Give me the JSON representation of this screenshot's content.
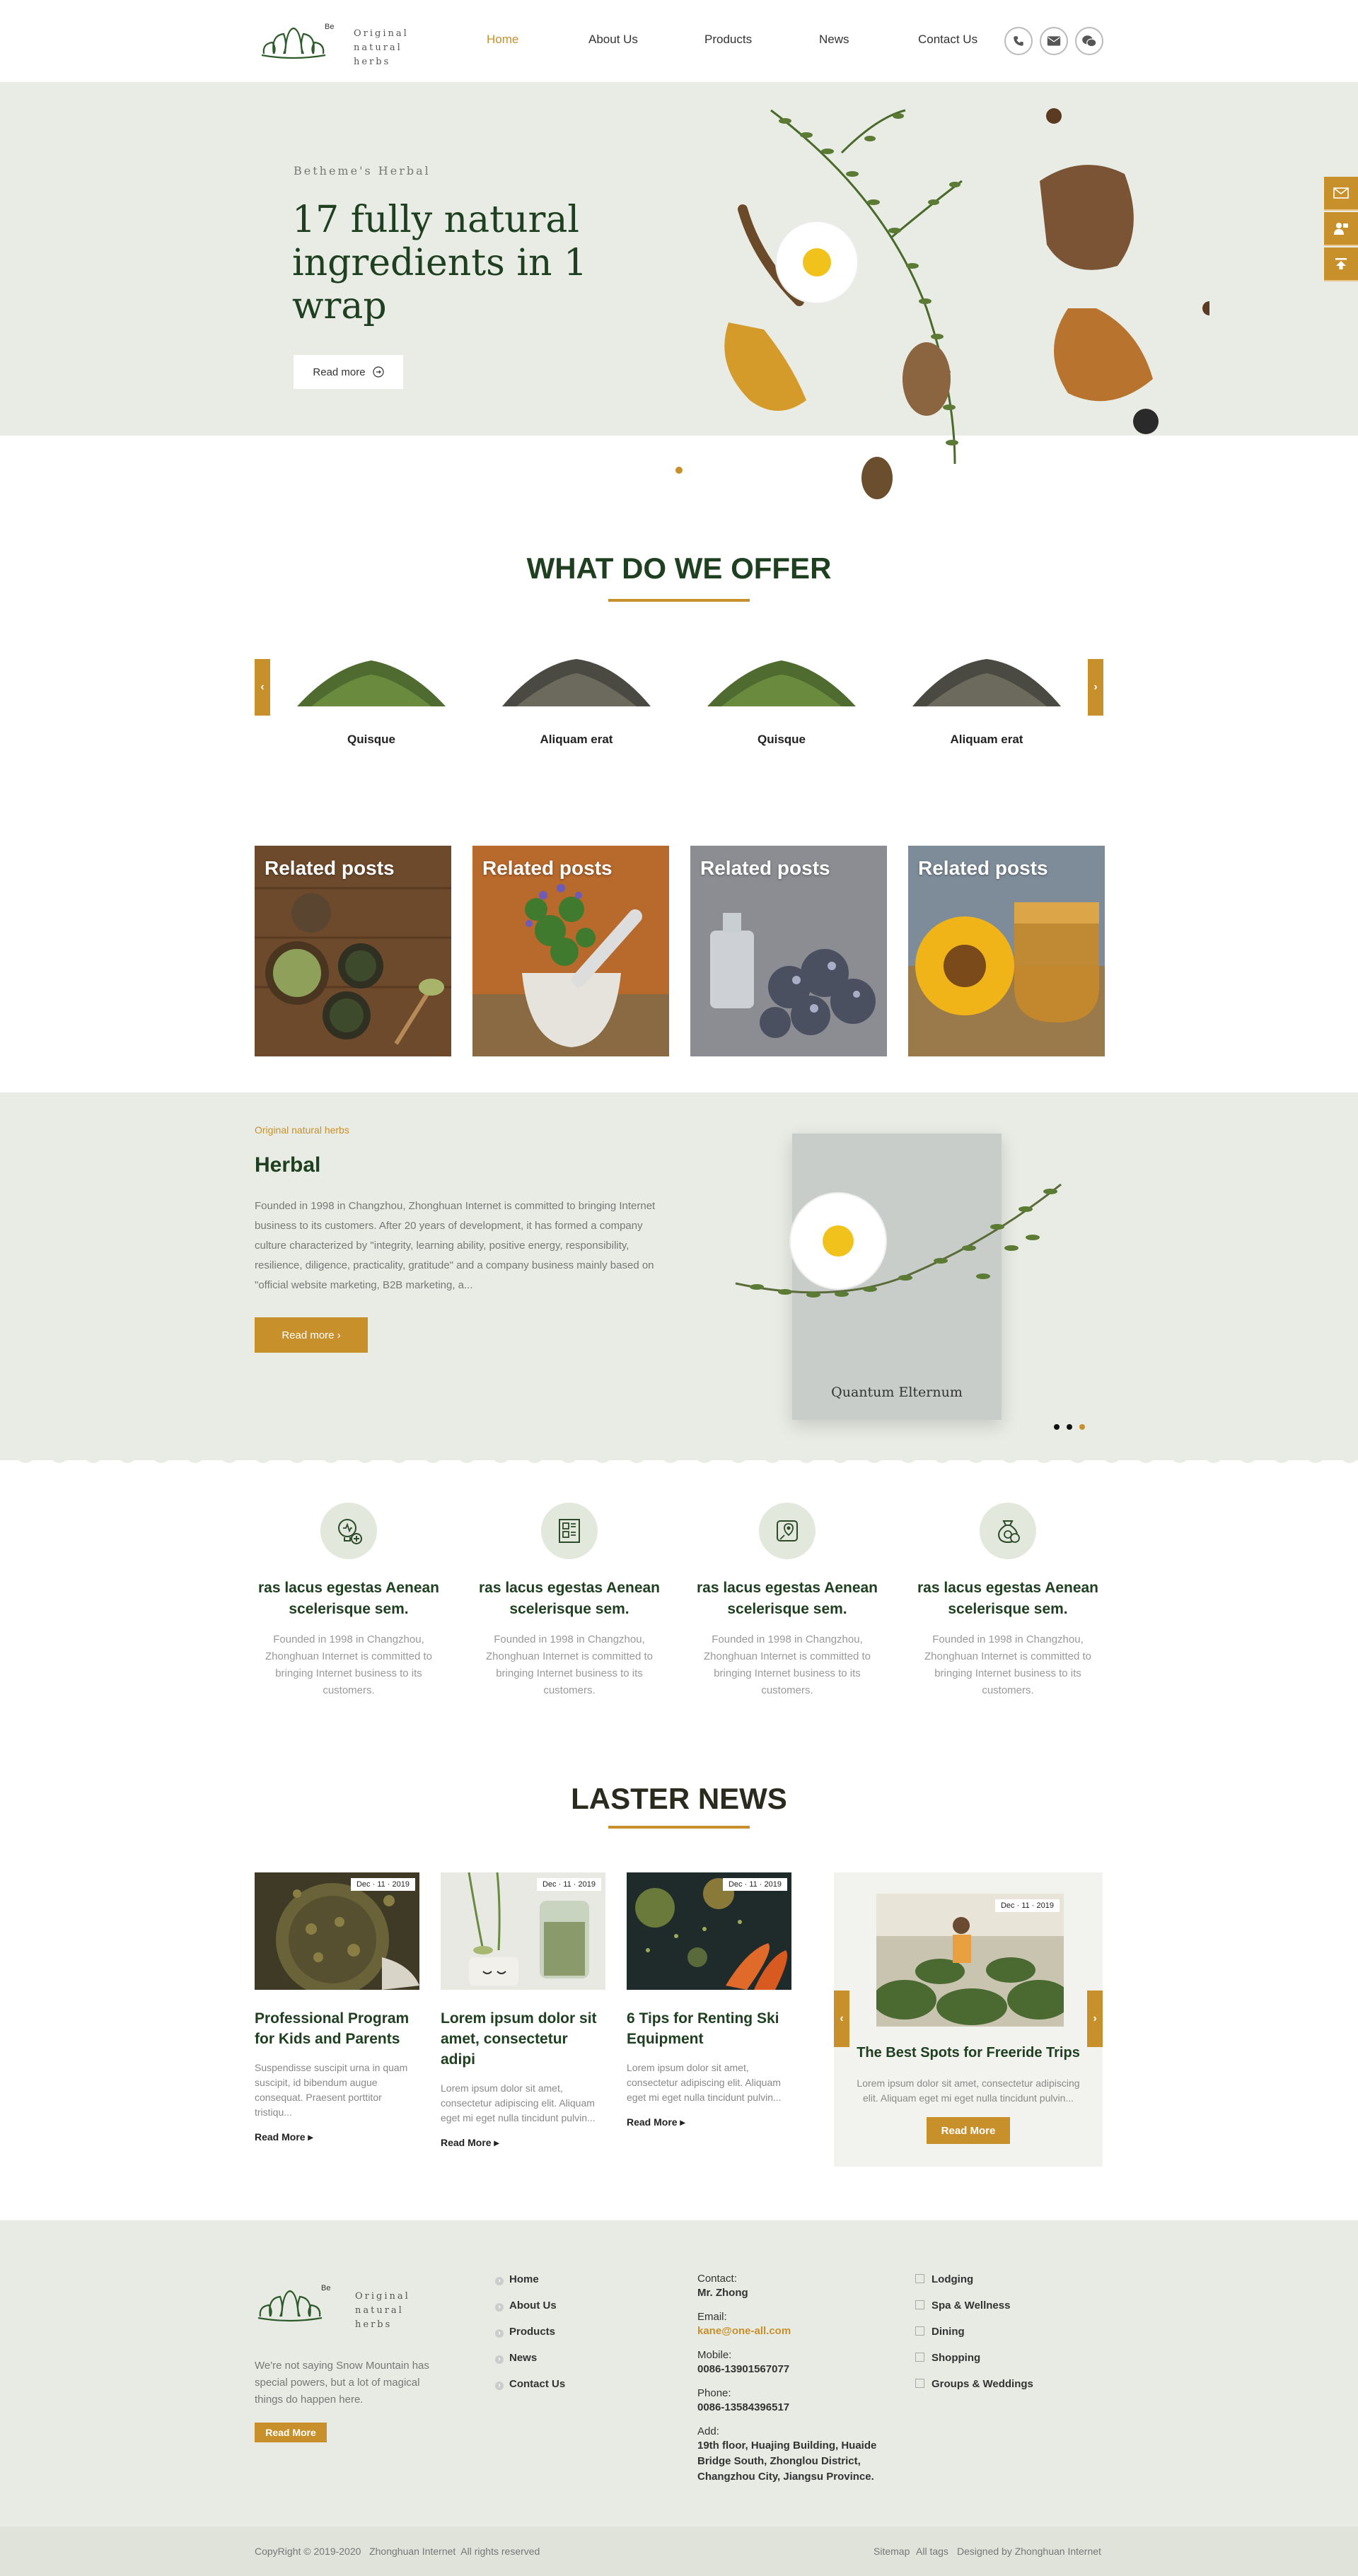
{
  "header": {
    "logo_mark": "Be",
    "logo_line1": "Original",
    "logo_line2": "natural herbs",
    "nav": [
      "Home",
      "About Us",
      "Products",
      "News",
      "Contact Us"
    ]
  },
  "hero": {
    "eyebrow": "Betheme's Herbal",
    "title": "17 fully natural ingredients in 1 wrap",
    "button": "Read more"
  },
  "offer": {
    "title": "WHAT DO WE OFFER",
    "products": [
      "Quisque",
      "Aliquam erat",
      "Quisque",
      "Aliquam erat"
    ]
  },
  "posts": [
    "Related posts",
    "Related posts",
    "Related posts",
    "Related posts"
  ],
  "herbal": {
    "eyebrow": "Original natural herbs",
    "title": "Herbal",
    "body": "Founded in 1998 in Changzhou, Zhonghuan Internet is committed to bringing Internet business to its customers. After 20 years of development, it has formed a company culture characterized by \"integrity, learning ability, positive energy, responsibility, resilience, diligence, practicality, gratitude\" and a company business mainly based on \"official website marketing, B2B marketing, a...",
    "button": "Read more",
    "box_caption": "Quantum Elternum"
  },
  "features": [
    {
      "title": "ras lacus egestas Aenean scelerisque sem.",
      "desc": "Founded in 1998 in Changzhou, Zhonghuan Internet is committed to bringing Internet business to its customers."
    },
    {
      "title": "ras lacus egestas Aenean scelerisque sem.",
      "desc": "Founded in 1998 in Changzhou, Zhonghuan Internet is committed to bringing Internet business to its customers."
    },
    {
      "title": "ras lacus egestas Aenean scelerisque sem.",
      "desc": "Founded in 1998 in Changzhou, Zhonghuan Internet is committed to bringing Internet business to its customers."
    },
    {
      "title": "ras lacus egestas Aenean scelerisque sem.",
      "desc": "Founded in 1998 in Changzhou, Zhonghuan Internet is committed to bringing Internet business to its customers."
    }
  ],
  "news": {
    "title": "LASTER NEWS",
    "items": [
      {
        "date": "Dec · 11 · 2019",
        "title": "Professional Program for Kids and Parents",
        "desc": "Suspendisse suscipit urna in quam suscipit, id bibendum augue consequat. Praesent porttitor tristiqu...",
        "more": "Read More"
      },
      {
        "date": "Dec · 11 · 2019",
        "title": "Lorem ipsum dolor sit amet, consectetur adipi",
        "desc": "Lorem ipsum dolor sit amet, consectetur adipiscing elit. Aliquam eget mi eget nulla tincidunt pulvin...",
        "more": "Read More"
      },
      {
        "date": "Dec · 11 · 2019",
        "title": "6 Tips for Renting Ski Equipment",
        "desc": "Lorem ipsum dolor sit amet, consectetur adipiscing elit. Aliquam eget mi eget nulla tincidunt pulvin...",
        "more": "Read More"
      }
    ],
    "featured": {
      "date": "Dec · 11 · 2019",
      "title": "The Best Spots for Freeride Trips",
      "desc": "Lorem ipsum dolor sit amet, consectetur adipiscing elit. Aliquam eget mi eget nulla tincidunt pulvin...",
      "button": "Read More"
    }
  },
  "footer": {
    "logo_mark": "Be",
    "logo_line1": "Original",
    "logo_line2": "natural herbs",
    "tagline": "We're not saying Snow Mountain has special powers, but a lot of magical things do happen here.",
    "button": "Read More",
    "links": [
      "Home",
      "About Us",
      "Products",
      "News",
      "Contact Us"
    ],
    "contact_label": "Contact:",
    "contact_value": "Mr. Zhong",
    "email_label": "Email:",
    "email_value": "kane@one-all.com",
    "mobile_label": "Mobile:",
    "mobile_value": "0086-13901567077",
    "phone_label": "Phone:",
    "phone_value": "0086-13584396517",
    "add_label": "Add:",
    "add_value": "19th floor, Huajing Building, Huaide Bridge South, Zhonglou District, Changzhou City, Jiangsu Province.",
    "services": [
      "Lodging",
      "Spa & Wellness",
      "Dining",
      "Shopping",
      "Groups & Weddings"
    ],
    "copyright": "CopyRight © 2019-2020   Zhonghuan Internet  All rights reserved",
    "bottom_links": [
      "Sitemap",
      "All tags",
      "Designed by Zhonghuan Internet"
    ]
  },
  "colors": {
    "accent": "#c8902a",
    "dark_green": "#1f4020",
    "light_green": "#e8ece4"
  },
  "icons": [
    "phone-icon",
    "mail-icon",
    "wechat-icon",
    "message-icon",
    "support-icon",
    "back-to-top-icon",
    "arrow-left-icon",
    "arrow-right-icon"
  ]
}
